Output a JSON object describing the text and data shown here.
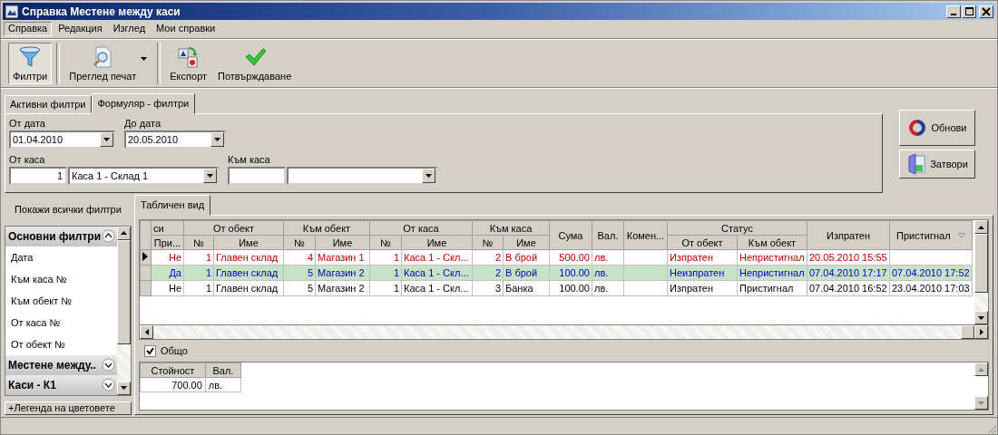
{
  "window": {
    "title": "Справка Местене между каси"
  },
  "menu": [
    {
      "label": "Справка",
      "selected": true
    },
    {
      "label": "Редакция",
      "selected": false
    },
    {
      "label": "Изглед",
      "selected": false
    },
    {
      "label": "Мои справки",
      "selected": false
    }
  ],
  "toolbar": [
    {
      "kind": "filter",
      "label": "Филтри",
      "pressed": true,
      "dropdown": false
    },
    {
      "kind": "preview",
      "label": "Преглед печат",
      "pressed": false,
      "dropdown": true
    },
    {
      "kind": "export",
      "label": "Експорт",
      "pressed": false,
      "dropdown": false
    },
    {
      "kind": "confirm",
      "label": "Потвърждаване",
      "pressed": false,
      "dropdown": false
    }
  ],
  "filter_tabs": [
    {
      "label": "Активни филтри",
      "selected": false
    },
    {
      "label": "Формуляр - филтри",
      "selected": true
    }
  ],
  "filters": {
    "from_date": {
      "label": "От дата",
      "value": "01.04.2010"
    },
    "to_date": {
      "label": "До дата",
      "value": "20.05.2010"
    },
    "from_cash": {
      "label": "От каса",
      "number": "1",
      "value": "Каса 1 - Склад 1"
    },
    "to_cash": {
      "label": "Към каса"
    }
  },
  "actions": [
    {
      "kind": "refresh",
      "label": "Обнови"
    },
    {
      "kind": "close",
      "label": "Затвори"
    }
  ],
  "sidebar": {
    "show_all": "Покажи всички филтри",
    "groups": [
      {
        "title": "Основни филтри",
        "expanded": true,
        "items": [
          "Дата",
          "Към каса №",
          "Към обект №",
          "От каса №",
          "От обект №"
        ]
      },
      {
        "title": "Местене между..",
        "expanded": false
      },
      {
        "title": "Каси - К1",
        "expanded": false
      }
    ],
    "legend": "+Легенда на цветовете"
  },
  "view_tabs": [
    {
      "label": "Табличен вид",
      "selected": true
    }
  ],
  "table": {
    "header": [
      {
        "kind": "group",
        "label": "си",
        "children": [
          "При..."
        ]
      },
      {
        "kind": "group",
        "label": "От обект",
        "children": [
          "№",
          "Име"
        ]
      },
      {
        "kind": "group",
        "label": "Към обект",
        "children": [
          "№",
          "Име"
        ]
      },
      {
        "kind": "group",
        "label": "От каса",
        "children": [
          "№",
          "Име"
        ]
      },
      {
        "kind": "group",
        "label": "Към каса",
        "children": [
          "№",
          "Име"
        ]
      },
      {
        "kind": "column",
        "label": "Сума",
        "sorted": false
      },
      {
        "kind": "column",
        "label": "Вал.",
        "sorted": false
      },
      {
        "kind": "column",
        "label": "Комен...",
        "sorted": false
      },
      {
        "kind": "group",
        "label": "Статус",
        "children": [
          "От обект",
          "Към обект"
        ]
      },
      {
        "kind": "column",
        "label": "Изпратен",
        "sorted": false
      },
      {
        "kind": "column",
        "label": "Пристигнал",
        "sorted": true
      }
    ],
    "rows": [
      {
        "current": true,
        "selected": false,
        "color": "#c00000",
        "cells": [
          "Не",
          "1",
          "Главен склад",
          "4",
          "Магазин 1",
          "1",
          "Каса 1 - Скл...",
          "2",
          "В брой",
          "500.00",
          "лв.",
          "",
          "Изпратен",
          "Непристигнал",
          "20.05.2010 15:55",
          ""
        ]
      },
      {
        "current": false,
        "selected": true,
        "color": "#0000c0",
        "cells": [
          "Да",
          "1",
          "Главен склад",
          "5",
          "Магазин 2",
          "1",
          "Каса 1 - Скл...",
          "2",
          "В брой",
          "100.00",
          "лв.",
          "",
          "Неизпратен",
          "Непристигнал",
          "07.04.2010 17:17",
          "07.04.2010 17:52"
        ]
      },
      {
        "current": false,
        "selected": false,
        "color": "#000000",
        "cells": [
          "Не",
          "1",
          "Главен склад",
          "5",
          "Магазин 2",
          "1",
          "Каса 1 - Скл...",
          "3",
          "Банка",
          "100.00",
          "лв.",
          "",
          "Изпратен",
          "Пристигнал",
          "07.04.2010 16:52",
          "23.04.2010 17:03"
        ]
      }
    ]
  },
  "totals": {
    "label": "Общо",
    "checked": true,
    "columns": [
      "Стойност",
      "Вал."
    ],
    "rows": [
      [
        "700.00",
        "лв."
      ]
    ]
  }
}
